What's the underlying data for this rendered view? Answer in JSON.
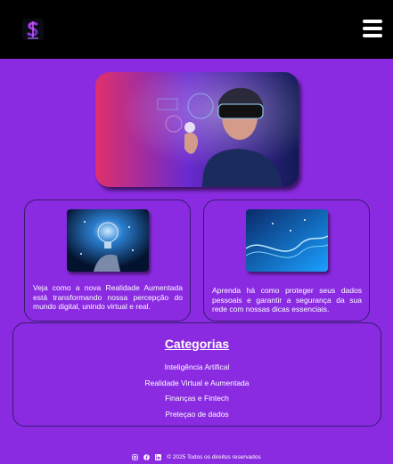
{
  "header": {
    "logo_icon": "dollar-logo-icon",
    "menu_icon": "hamburger-menu-icon"
  },
  "hero": {
    "image": "vr-headset-person-image"
  },
  "cards": [
    {
      "image": "glowing-lightbulb-hand-image",
      "text": "Veja como a nova Realidade Aumentada está transformando nossa percepção do mundo digital, unindo virtual e real."
    },
    {
      "image": "blue-data-wave-image",
      "text": "Aprenda há como proteger seus dados pessoais e garantir a segurança da sua rede com nossas dicas essenciais."
    }
  ],
  "categories": {
    "title": "Categorias",
    "items": [
      "Inteligência Artifical",
      "Realidade Virtual e Aumentada",
      "Finanças e Fintech",
      "Preteçao de dados"
    ]
  },
  "footer": {
    "icons": [
      "instagram-icon",
      "facebook-icon",
      "linkedin-icon"
    ],
    "copyright": "© 2025 Todos os direitos reservados"
  },
  "colors": {
    "background": "#8a2be2",
    "header": "#000000",
    "border": "#3a1a6e"
  }
}
